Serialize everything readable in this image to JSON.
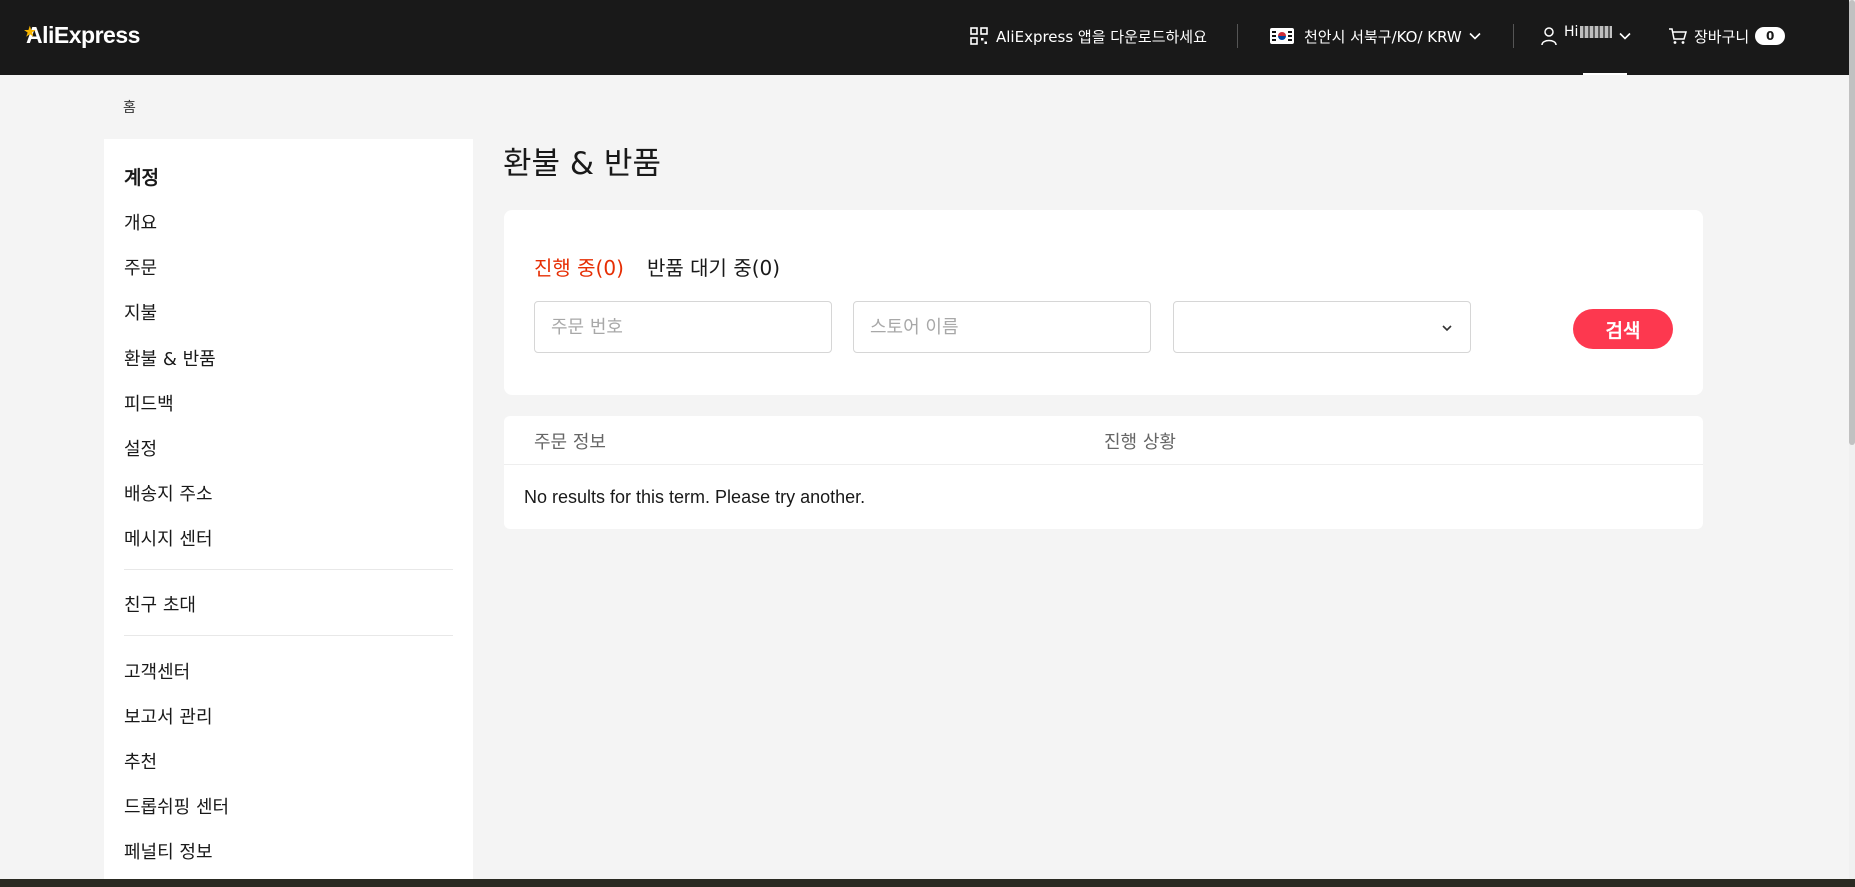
{
  "header": {
    "logo_text": "AliExpress",
    "app_download": "AliExpress 앱을 다운로드하세요",
    "region": "천안시 서북구/KO/ KRW",
    "user_greeting": "Hi",
    "cart_label": "장바구니",
    "cart_count": "0"
  },
  "breadcrumb": {
    "home": "홈"
  },
  "sidebar": {
    "title": "계정",
    "group1": [
      "개요",
      "주문",
      "지불",
      "환불 & 반품",
      "피드백",
      "설정",
      "배송지 주소",
      "메시지 센터"
    ],
    "group2": [
      "친구 초대"
    ],
    "group3": [
      "고객센터",
      "보고서 관리",
      "추천",
      "드롭쉬핑 센터",
      "페널티 정보"
    ]
  },
  "main": {
    "title": "환불 & 반품",
    "tabs": {
      "in_progress": "진행 중(0)",
      "awaiting_return": "반품 대기 중(0)"
    },
    "filters": {
      "order_placeholder": "주문 번호",
      "store_placeholder": "스토어 이름",
      "select_value": "",
      "search_label": "검색"
    },
    "table": {
      "col_order_info": "주문 정보",
      "col_status": "진행 상황",
      "empty_message": "No results for this term. Please try another."
    }
  },
  "colors": {
    "accent": "#fd384f",
    "active_tab": "#e62e04",
    "header_bg": "#191919"
  }
}
